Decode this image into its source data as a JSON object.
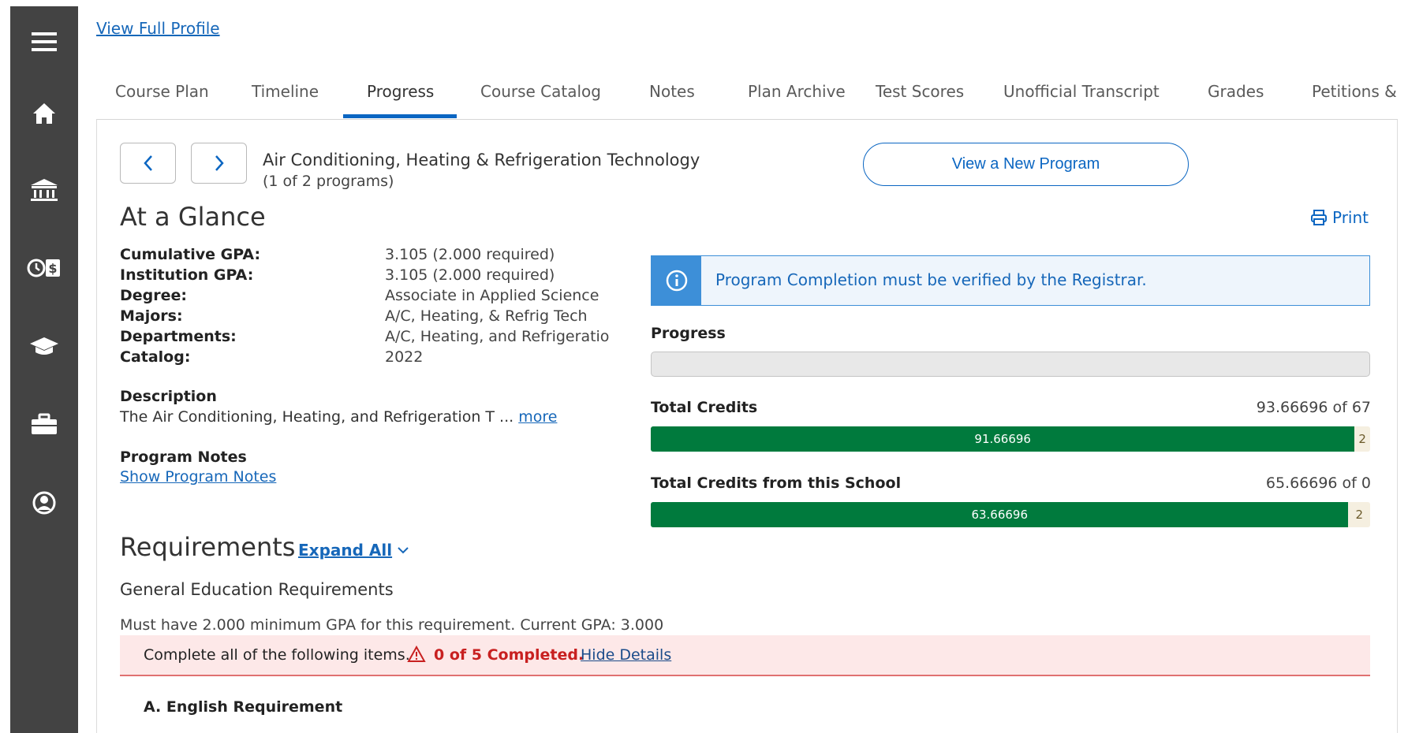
{
  "sidebar": {
    "icons": [
      "menu-icon",
      "home-icon",
      "institution-icon",
      "finance-icon",
      "graduation-cap-icon",
      "briefcase-icon",
      "user-profile-icon"
    ]
  },
  "profile_link": "View Full Profile",
  "tabs": [
    {
      "label": "Course Plan"
    },
    {
      "label": "Timeline"
    },
    {
      "label": "Progress",
      "active": true
    },
    {
      "label": "Course Catalog"
    },
    {
      "label": "Notes"
    },
    {
      "label": "Plan Archive"
    },
    {
      "label": "Test Scores"
    },
    {
      "label": "Unofficial Transcript"
    },
    {
      "label": "Grades"
    },
    {
      "label": "Petitions &"
    }
  ],
  "program": {
    "title": "Air Conditioning, Heating & Refrigeration Technology",
    "count": "(1 of 2 programs)",
    "view_new_label": "View a New Program"
  },
  "glance": {
    "title": "At a Glance",
    "print_label": "Print",
    "fields": [
      {
        "label": "Cumulative GPA:",
        "value": "3.105 (2.000 required)"
      },
      {
        "label": "Institution GPA:",
        "value": "3.105 (2.000 required)"
      },
      {
        "label": "Degree:",
        "value": "Associate in Applied Science"
      },
      {
        "label": "Majors:",
        "value": "A/C, Heating, & Refrig Tech"
      },
      {
        "label": "Departments:",
        "value": "A/C, Heating, and Refrigeratio"
      },
      {
        "label": "Catalog:",
        "value": "2022"
      }
    ],
    "description_label": "Description",
    "description_text": "The Air Conditioning, Heating, and Refrigeration T ...",
    "more_link": "more",
    "notes_label": "Program Notes",
    "notes_link": "Show Program Notes"
  },
  "alert": {
    "text": "Program Completion must be verified by the Registrar."
  },
  "progress": {
    "label": "Progress",
    "total_credits": {
      "label": "Total Credits",
      "value_text": "93.66696 of 67",
      "completed": "91.66696",
      "remaining": "2",
      "completed_fraction": 0.9785
    },
    "school_credits": {
      "label": "Total Credits from this School",
      "value_text": "65.66696 of 0",
      "completed": "63.66696",
      "remaining": "2",
      "completed_fraction": 0.9698
    }
  },
  "requirements": {
    "title": "Requirements",
    "expand_all": "Expand All",
    "group_title": "General Education Requirements",
    "min_gpa_text": "Must have 2.000 minimum GPA for this requirement. Current GPA: 3.000",
    "banner_text": "Complete all of the following items.",
    "banner_status": "0 of 5 Completed.",
    "banner_link": "Hide Details",
    "first_item": "A. English Requirement"
  },
  "colors": {
    "sidebar": "#434343",
    "accent": "#0b66c2",
    "progress_fill": "#007a3d",
    "alert_blue": "#3d8fd8",
    "warning_red": "#c82020"
  }
}
